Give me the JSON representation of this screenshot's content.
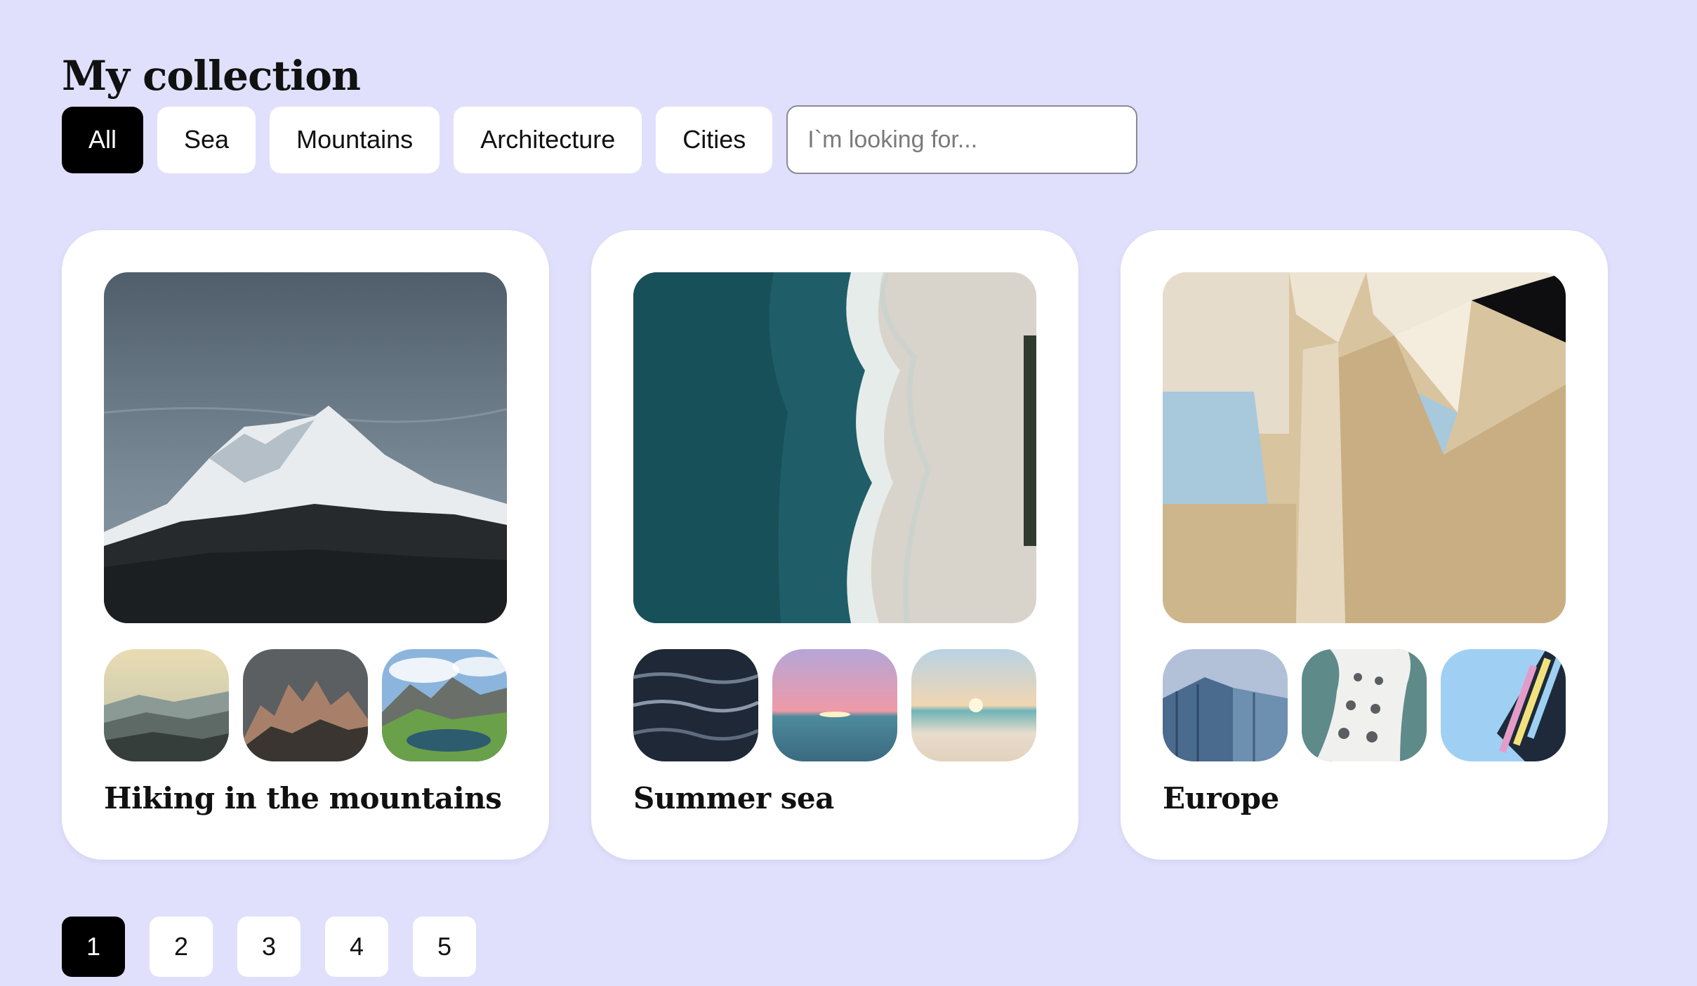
{
  "page": {
    "title": "My collection"
  },
  "filters": [
    {
      "label": "All",
      "active": true
    },
    {
      "label": "Sea",
      "active": false
    },
    {
      "label": "Mountains",
      "active": false
    },
    {
      "label": "Architecture",
      "active": false
    },
    {
      "label": "Cities",
      "active": false
    }
  ],
  "search": {
    "placeholder": "I`m looking for...",
    "value": ""
  },
  "cards": [
    {
      "title": "Hiking in the mountains"
    },
    {
      "title": "Summer sea"
    },
    {
      "title": "Europe"
    }
  ],
  "pagination": {
    "pages": [
      "1",
      "2",
      "3",
      "4",
      "5"
    ],
    "current": "1"
  },
  "colors": {
    "background": "#e0e0fc",
    "active": "#000000",
    "card": "#ffffff"
  }
}
